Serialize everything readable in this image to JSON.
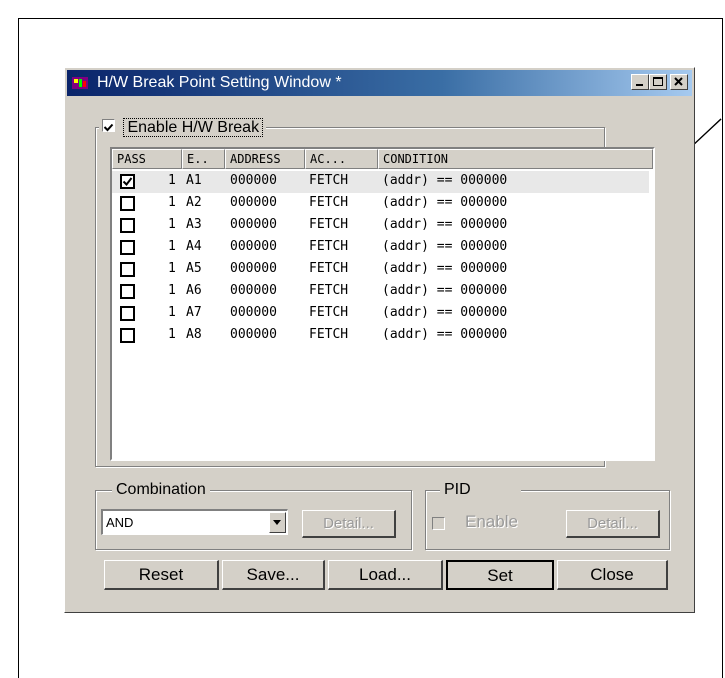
{
  "window": {
    "title": "H/W Break Point Setting Window *"
  },
  "enable_hw_break": {
    "label": "Enable H/W Break",
    "checked": true
  },
  "list": {
    "columns": [
      "PASS",
      "E..",
      "ADDRESS",
      "AC...",
      "CONDITION"
    ],
    "rows": [
      {
        "checked": true,
        "pass": "1",
        "event": "A1",
        "address": "000000",
        "access": "FETCH",
        "condition": "(addr) == 000000"
      },
      {
        "checked": false,
        "pass": "1",
        "event": "A2",
        "address": "000000",
        "access": "FETCH",
        "condition": "(addr) == 000000"
      },
      {
        "checked": false,
        "pass": "1",
        "event": "A3",
        "address": "000000",
        "access": "FETCH",
        "condition": "(addr) == 000000"
      },
      {
        "checked": false,
        "pass": "1",
        "event": "A4",
        "address": "000000",
        "access": "FETCH",
        "condition": "(addr) == 000000"
      },
      {
        "checked": false,
        "pass": "1",
        "event": "A5",
        "address": "000000",
        "access": "FETCH",
        "condition": "(addr) == 000000"
      },
      {
        "checked": false,
        "pass": "1",
        "event": "A6",
        "address": "000000",
        "access": "FETCH",
        "condition": "(addr) == 000000"
      },
      {
        "checked": false,
        "pass": "1",
        "event": "A7",
        "address": "000000",
        "access": "FETCH",
        "condition": "(addr) == 000000"
      },
      {
        "checked": false,
        "pass": "1",
        "event": "A8",
        "address": "000000",
        "access": "FETCH",
        "condition": "(addr) == 000000"
      }
    ]
  },
  "combination": {
    "label": "Combination",
    "value": "AND",
    "detail_label": "Detail..."
  },
  "pid": {
    "label": "PID",
    "enable_label": "Enable",
    "detail_label": "Detail..."
  },
  "buttons": {
    "reset": "Reset",
    "save": "Save...",
    "load": "Load...",
    "set": "Set",
    "close": "Close"
  }
}
